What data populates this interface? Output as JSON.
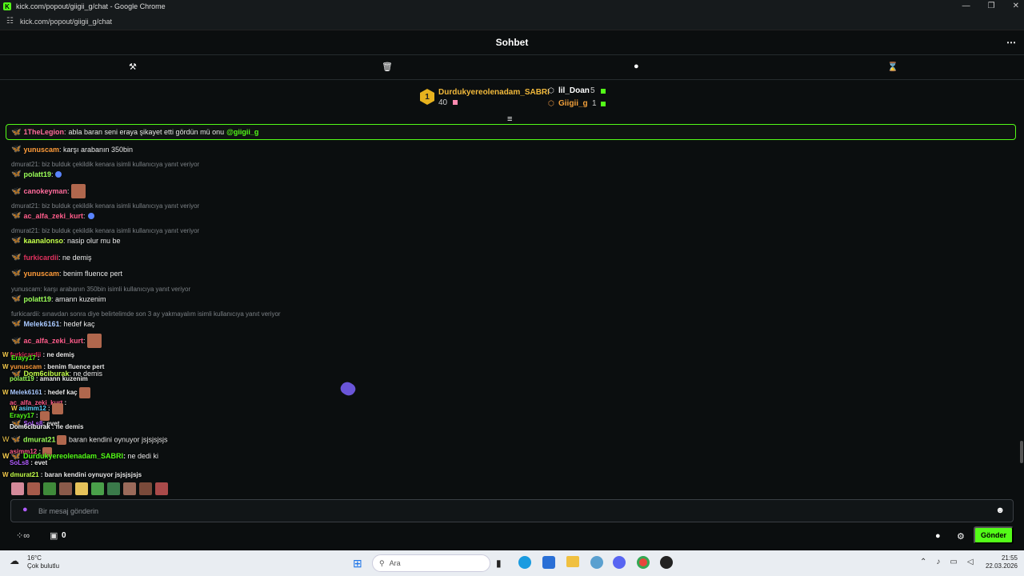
{
  "window": {
    "title": "kick.com/popout/giigii_g/chat - Google Chrome",
    "url": "kick.com/popout/giigii_g/chat"
  },
  "header": {
    "title": "Sohbet"
  },
  "leaderboard": {
    "first": {
      "rank": "1",
      "name": "Durdukyereolenadam_SABRI",
      "count": "40"
    },
    "second": {
      "name": "lil_Doan",
      "count": "5"
    },
    "third": {
      "name": "Giigii_g",
      "count": "1"
    }
  },
  "pinned": {
    "user": "1TheLegion",
    "text": "abla baran seni eraya şikayet etti gördün mü onu",
    "mention": "@giigii_g"
  },
  "messages": [
    {
      "user": "yunuscam",
      "color": "#ff9c3a",
      "text": "karşı arabanın 350bin"
    },
    {
      "reply": "dmurat21: biz bulduk çekildik kenara isimli kullanıcıya yanıt veriyor",
      "user": "polatt19",
      "color": "#9bff58",
      "text": ""
    },
    {
      "user": "canokeyman",
      "color": "#ff6b9b",
      "text": ""
    },
    {
      "reply": "dmurat21: biz bulduk çekildik kenara isimli kullanıcıya yanıt veriyor",
      "user": "ac_alfa_zeki_kurt",
      "color": "#ff5c8a",
      "text": ""
    },
    {
      "reply": "dmurat21: biz bulduk çekildik kenara isimli kullanıcıya yanıt veriyor",
      "user": "kaanalonso",
      "color": "#c4ff4a",
      "text": "nasip olur mu be"
    },
    {
      "user": "furkicardii",
      "color": "#e0315e",
      "text": "ne demiş"
    },
    {
      "user": "yunuscam",
      "color": "#ff9c3a",
      "text": "benim fluence pert"
    },
    {
      "reply": "yunuscam: karşı arabanın 350bin isimli kullanıcıya yanıt veriyor",
      "user": "polatt19",
      "color": "#9bff58",
      "text": "amann kuzenim"
    },
    {
      "reply": "furkicardii: sınavdan sonra diye belirtelimde son 3 ay yakmayalım isimli kullanıcıya yanıt veriyor",
      "user": "Melek6161",
      "color": "#a8c8ff",
      "text": "hedef kaç"
    },
    {
      "user": "ac_alfa_zeki_kurt",
      "color": "#ff5c8a",
      "text": ""
    }
  ],
  "overlay": [
    {
      "user": "furkicardii",
      "text": "ne demiş"
    },
    {
      "user": "Erayy17",
      "text": ""
    },
    {
      "user": "yunuscam",
      "text": "benim fluence pert"
    },
    {
      "user": "Dom6ciburak",
      "text": "ne demis"
    },
    {
      "user": "polatt19",
      "text": "amann kuzenim"
    },
    {
      "user": "Melek6161",
      "text": "hedef kaç"
    },
    {
      "user": "ac_alfa_zeki_kurt",
      "text": ""
    },
    {
      "user": "asimm12",
      "text": ""
    },
    {
      "user": "Erayy17",
      "text": ""
    },
    {
      "user": "SoLs8",
      "text": "evet"
    },
    {
      "user": "Dom6ciburak",
      "text": "ne demis"
    },
    {
      "user": "dmurat21",
      "text": "baran kendini oynuyor jsjsjsjsjs"
    },
    {
      "user": "asimm12",
      "text": ""
    },
    {
      "user": "Durdukyereolenadam_SABRI",
      "text": "ne dedi ki"
    },
    {
      "user": "SoLs8",
      "text": "evet"
    },
    {
      "user": "dmurat21",
      "text": "baran kendini oynuyor jsjsjsjsjs"
    }
  ],
  "input": {
    "placeholder": "Bir mesaj gönderin"
  },
  "bottom": {
    "points": "0",
    "send_label": "Gönder"
  },
  "taskbar": {
    "temp": "16°C",
    "weather": "Çok bulutlu",
    "search": "Ara",
    "time": "21:55",
    "date": "22.03.2026"
  },
  "colors": {
    "accent": "#53fc18",
    "background": "#0b0e0f"
  }
}
